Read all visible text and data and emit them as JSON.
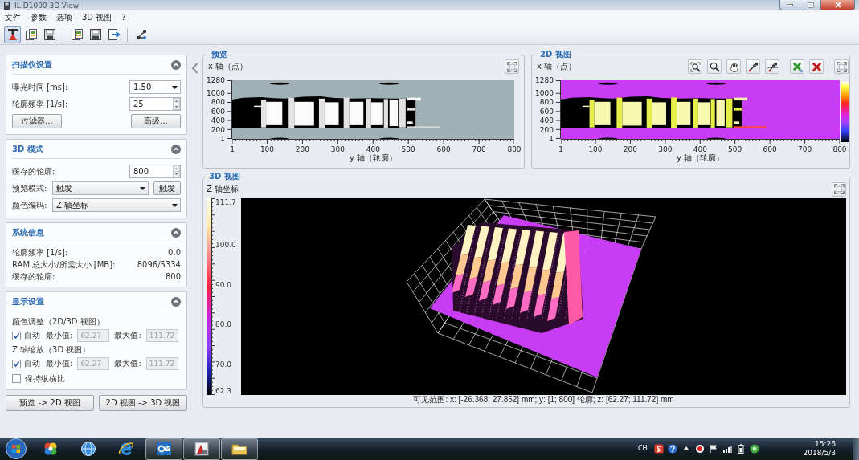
{
  "window": {
    "title": "IL-D1000 3D-View"
  },
  "menu": [
    "文件",
    "参数",
    "选项",
    "3D 视图",
    "?"
  ],
  "toolbar": {
    "groups": [
      [
        {
          "selected": true
        },
        {
          "selected": false
        },
        {
          "selected": false
        }
      ],
      [
        {
          "selected": false
        },
        {
          "selected": false
        },
        {
          "selected": false
        }
      ],
      [
        {
          "selected": false
        }
      ]
    ]
  },
  "left_panel": {
    "sections": [
      {
        "title": "扫描仪设置",
        "expanded": true,
        "rows": [
          {
            "kind": "dropdown",
            "label": "曝光时间 [ms]:",
            "value": "1.50"
          },
          {
            "kind": "spinner",
            "label": "轮廓频率 [1/s]:",
            "value": "25"
          },
          {
            "kind": "buttons",
            "buttons": [
              "过滤器...",
              "高级..."
            ]
          }
        ]
      },
      {
        "title": "3D 模式",
        "expanded": true,
        "rows": [
          {
            "kind": "spinner",
            "label": "缓存的轮廓:",
            "value": "800"
          },
          {
            "kind": "dropdown_button",
            "label": "预览模式:",
            "value": "触发",
            "button": "触发"
          },
          {
            "kind": "wide_dropdown",
            "label": "颜色编码:",
            "value": "Z 轴坐标"
          }
        ]
      },
      {
        "title": "系统信息",
        "expanded": true,
        "rows": [
          {
            "kind": "info",
            "label": "轮廓频率 [1/s]:",
            "value": "0.0"
          },
          {
            "kind": "info",
            "label": "RAM 总大小/所需大小 [MB]:",
            "value": "8096/5334"
          },
          {
            "kind": "info",
            "label": "缓存的轮廓:",
            "value": "800"
          }
        ]
      },
      {
        "title": "显示设置",
        "expanded": true,
        "rows": [
          {
            "kind": "heading",
            "label": "颜色调整（2D/3D 视图）"
          },
          {
            "kind": "range",
            "label": "自动",
            "checked": true,
            "min_label": "最小值:",
            "min": "62.27",
            "max_label": "最大值:",
            "max": "111.72",
            "disabled": true
          },
          {
            "kind": "heading",
            "label": "Z 轴缩放（3D 视图）"
          },
          {
            "kind": "range",
            "label": "自动",
            "checked": true,
            "min_label": "最小值:",
            "min": "62.27",
            "max_label": "最大值:",
            "max": "111.72",
            "disabled": true
          },
          {
            "kind": "checkbox",
            "label": "保持纵横比",
            "checked": false
          }
        ]
      }
    ],
    "buttons": [
      "预览 -> 2D 视图",
      "2D 视图 -> 3D 视图"
    ]
  },
  "views": [
    {
      "kind": "preview",
      "title": "预览",
      "y_axis_label": "x 轴（点）",
      "y_ticks": [
        "1280",
        "1000",
        "800",
        "600",
        "400",
        "200",
        "1"
      ],
      "x_ticks": [
        "1",
        "100",
        "200",
        "300",
        "400",
        "500",
        "600",
        "700",
        "800"
      ],
      "x_axis_label": "y 轴（轮廓）"
    },
    {
      "kind": "color_2d",
      "title": "2D 视图",
      "y_axis_label": "x 轴（点）",
      "y_ticks": [
        "1280",
        "1000",
        "800",
        "600",
        "400",
        "200",
        "1"
      ],
      "x_ticks": [
        "1",
        "100",
        "200",
        "300",
        "400",
        "500",
        "600",
        "700",
        "800"
      ],
      "x_axis_label": "y 轴（轮廓）"
    }
  ],
  "view_3d": {
    "title": "3D 视图",
    "scale_label": "Z 轴坐标",
    "scale_ticks": [
      "111.7",
      "100.0",
      "90.0",
      "80.0",
      "70.0",
      "62.3"
    ],
    "status": "可见范围: x: [-26.368; 27.852] mm; y: [1; 800] 轮廓; z: [62.27; 111.72] mm"
  },
  "taskbar": {
    "apps": [
      {
        "running": false
      },
      {
        "running": false
      },
      {
        "running": false
      },
      {
        "running": true
      },
      {
        "running": true
      },
      {
        "running": true
      }
    ],
    "language": "CH",
    "time": "15:26",
    "date": "2018/5/3"
  }
}
